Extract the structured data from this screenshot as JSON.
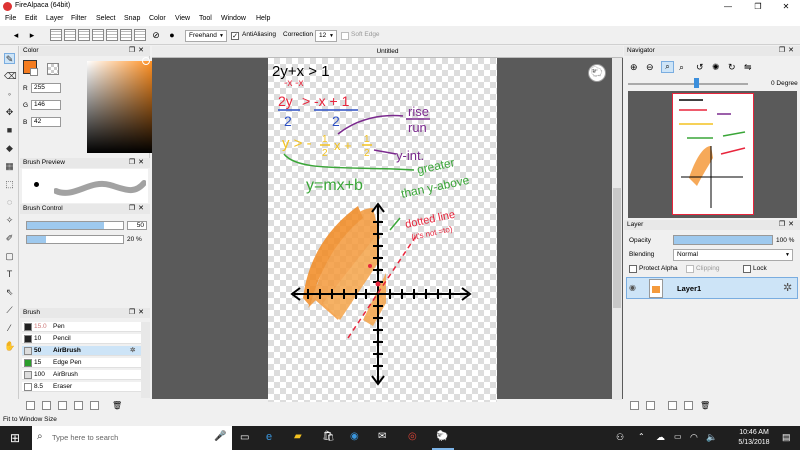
{
  "window": {
    "title": "FireAlpaca (64bit)",
    "minimize": "—",
    "maximize": "❐",
    "close": "✕"
  },
  "menu": [
    "File",
    "Edit",
    "Layer",
    "Filter",
    "Select",
    "Snap",
    "Color",
    "View",
    "Tool",
    "Window",
    "Help"
  ],
  "toolbar": {
    "tool_mode": "Freehand",
    "antialiasing_label": "AntiAliasing",
    "antialiasing_checked": true,
    "correction_label": "Correction",
    "correction_value": "12",
    "soft_edge_label": "Soft Edge",
    "soft_edge_checked": false
  },
  "color_panel": {
    "title": "Color",
    "primary_color": "#f47c20",
    "r_label": "R",
    "r": "255",
    "g_label": "G",
    "g": "146",
    "b_label": "B",
    "b": "42"
  },
  "brush_preview": {
    "title": "Brush Preview"
  },
  "brush_control": {
    "title": "Brush Control",
    "size": "50",
    "opacity": "20 %",
    "size_fraction": 0.8,
    "opacity_fraction": 0.2
  },
  "brush_panel": {
    "title": "Brush",
    "items": [
      {
        "size": "15.0",
        "name": "Pen",
        "color": "#222222"
      },
      {
        "size": "10",
        "name": "Pencil",
        "color": "#222222"
      },
      {
        "size": "50",
        "name": "AirBrush",
        "color": "#dddddd",
        "active": true
      },
      {
        "size": "15",
        "name": "Edge Pen",
        "color": "#2a9d2a"
      },
      {
        "size": "100",
        "name": "AirBrush",
        "color": "#dddddd"
      },
      {
        "size": "8.5",
        "name": "Eraser",
        "color": "#ffffff"
      }
    ]
  },
  "canvas": {
    "tab_title": "Untitled",
    "drawing_text": {
      "line1": "2y+x > 1",
      "line2": "-x   -x",
      "line3_num": "2y",
      "line3_op": ">",
      "line3_rhs": "-x + 1",
      "line3_den1": "2",
      "line3_den2": "2",
      "rise": "rise",
      "run": "run",
      "y_eq": "y > -",
      "frac1_n": "1",
      "frac1_d": "2",
      "x_plus": "x +",
      "frac2_n": "1",
      "frac2_d": "2",
      "y_int": "y-int.",
      "slope_form": "y=mx+b",
      "greater1": "greater",
      "greater2": "than y-above",
      "dotted1": "dotted line",
      "dotted2": "(it's not =to)"
    }
  },
  "navigator": {
    "title": "Navigator",
    "angle": "0 Degree"
  },
  "layer_panel": {
    "title": "Layer",
    "opacity_label": "Opacity",
    "opacity_value": "100 %",
    "opacity_fraction": 1.0,
    "blending_label": "Blending",
    "blending_value": "Normal",
    "protect_alpha_label": "Protect Alpha",
    "clipping_label": "Clipping",
    "lock_label": "Lock",
    "layers": [
      {
        "name": "Layer1"
      }
    ]
  },
  "status": {
    "text": "Fit to Window Size"
  },
  "taskbar": {
    "search_placeholder": "Type here to search",
    "time": "10:46 AM",
    "date": "5/13/2018"
  },
  "colors": {
    "orange": "#f47c20",
    "red": "#e8253c",
    "purple": "#7b2a8e",
    "green": "#3aa638",
    "yellow": "#f3c220"
  }
}
